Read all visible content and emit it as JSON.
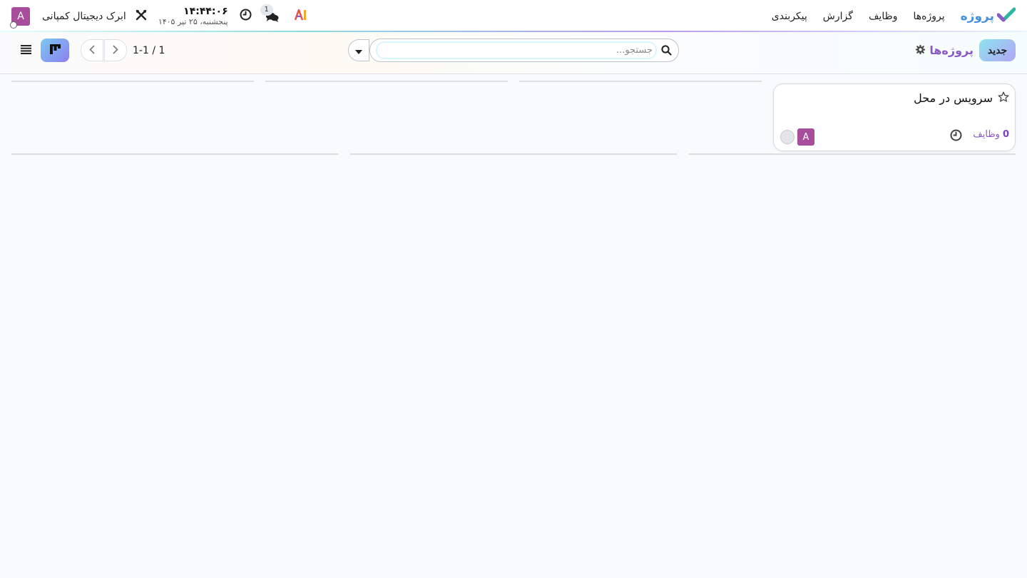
{
  "navbar": {
    "app_name": "پروژه",
    "menu": [
      "پروژه‌ها",
      "وظایف",
      "گزارش",
      "پیکربندی"
    ],
    "company": "ابرک دیجیتال کمپانی",
    "clock_time": "۱۴:۴۴:۰۶",
    "clock_date": "پنجشنبه، ۲۵ تیر ۱۴۰۵",
    "chat_count": "1",
    "user_initial": "A",
    "icons": [
      "app-logo-icon",
      "ai-icon",
      "chat-icon",
      "activity-clock-icon",
      "tools-icon"
    ]
  },
  "control": {
    "new_label": "جدید",
    "breadcrumb": "پروژه‌ها",
    "search_placeholder": "جستجو...",
    "pager": "1-1 / 1"
  },
  "card": {
    "title": "سرویس در محل",
    "tasks_count": "0",
    "tasks_label": "وظایف",
    "avatar_initial": "A"
  },
  "colors": {
    "accent": "#8b5ac8",
    "avatar": "#a84d9c",
    "brand_blue": "#4a90d9"
  }
}
